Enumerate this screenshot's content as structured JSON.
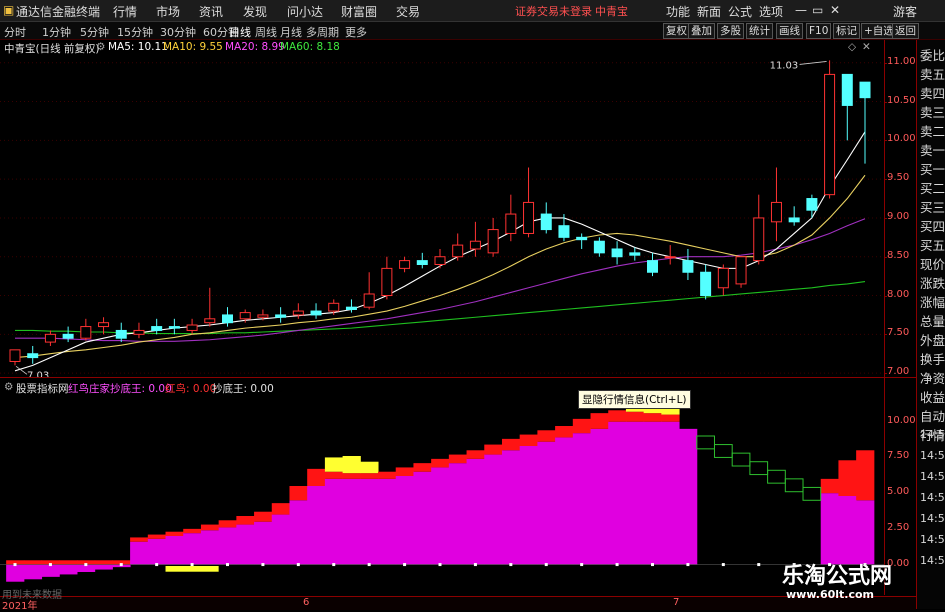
{
  "menubar": {
    "app_title": "通达信金融终端",
    "items": [
      "行情",
      "市场",
      "资讯",
      "发现",
      "问小达",
      "财富圈",
      "交易"
    ],
    "login_notice": "证券交易未登录",
    "stock_name": "中青宝",
    "right_items": [
      "功能",
      "新面",
      "公式",
      "选项"
    ],
    "guest_label": "游客"
  },
  "periodbar": {
    "periods": [
      "分时",
      "1分钟",
      "5分钟",
      "15分钟",
      "30分钟",
      "60分钟",
      "日线",
      "周线",
      "月线",
      "多周期",
      "更多"
    ],
    "active_period": "日线",
    "right_buttons": [
      "复权",
      "叠加",
      "多股",
      "统计",
      "画线",
      "F10",
      "标记",
      "+自选",
      "返回"
    ]
  },
  "main_chart": {
    "title": "中青宝(日线 前复权)",
    "ma5": "MA5: 10.11",
    "ma10": "MA10: 9.55",
    "ma20": "MA20: 8.99",
    "ma60": "MA60: 8.18",
    "high_label": "11.03",
    "low_label": "7.03",
    "y_ticks": [
      "11.00",
      "10.50",
      "10.00",
      "9.50",
      "9.00",
      "8.50",
      "8.00",
      "7.50",
      "7.00"
    ]
  },
  "sub_chart": {
    "name": "股票指标网",
    "line1": "红鸟庄家抄底王: 0.00",
    "line2": "红鸟: 0.00",
    "line3": "抄底王: 0.00",
    "y_ticks": [
      "10.00",
      "7.50",
      "5.00",
      "2.50",
      "0.00"
    ],
    "right_overflow": [
      "14:50",
      "14:50",
      "14:50",
      "14:50",
      "14:50",
      "14:50",
      "14:50"
    ]
  },
  "tooltip": "显隐行情信息(Ctrl+L)",
  "x_axis": {
    "year": "2021年",
    "months": [
      "6",
      "7"
    ]
  },
  "footnote": "用到未来数据",
  "sidebar_items": [
    "委比",
    "卖五",
    "卖四",
    "卖三",
    "卖二",
    "卖一",
    "买一",
    "买二",
    "买三",
    "买四",
    "买五",
    "现价",
    "涨跌",
    "涨幅",
    "总量",
    "外盘",
    "换手",
    "净资",
    "收益",
    "自动",
    "行情"
  ],
  "watermark": {
    "title": "乐淘公式网",
    "url": "www.60lt.com"
  },
  "chart_data": {
    "type": "candlestick",
    "x": [
      1,
      2,
      3,
      4,
      5,
      6,
      7,
      8,
      9,
      10,
      11,
      12,
      13,
      14,
      15,
      16,
      17,
      18,
      19,
      20,
      21,
      22,
      23,
      24,
      25,
      26,
      27,
      28,
      29,
      30,
      31,
      32,
      33,
      34,
      35,
      36,
      37,
      38,
      39,
      40,
      41,
      42,
      43,
      44,
      45,
      46,
      47,
      48,
      49
    ],
    "open": [
      7.15,
      7.25,
      7.4,
      7.5,
      7.45,
      7.6,
      7.55,
      7.5,
      7.6,
      7.6,
      7.55,
      7.65,
      7.75,
      7.7,
      7.72,
      7.75,
      7.75,
      7.8,
      7.8,
      7.85,
      7.85,
      8.0,
      8.35,
      8.45,
      8.4,
      8.5,
      8.6,
      8.55,
      8.8,
      8.8,
      9.05,
      8.9,
      8.75,
      8.7,
      8.6,
      8.55,
      8.45,
      8.5,
      8.45,
      8.3,
      8.1,
      8.15,
      8.45,
      8.95,
      9.0,
      9.25,
      9.3,
      10.85,
      10.75
    ],
    "close": [
      7.3,
      7.2,
      7.5,
      7.45,
      7.6,
      7.65,
      7.45,
      7.55,
      7.55,
      7.58,
      7.62,
      7.7,
      7.65,
      7.78,
      7.75,
      7.72,
      7.8,
      7.75,
      7.9,
      7.82,
      8.02,
      8.35,
      8.45,
      8.4,
      8.5,
      8.65,
      8.7,
      8.85,
      9.05,
      9.2,
      8.85,
      8.75,
      8.72,
      8.55,
      8.5,
      8.52,
      8.3,
      8.5,
      8.3,
      8.0,
      8.35,
      8.5,
      9.0,
      9.2,
      8.95,
      9.1,
      10.85,
      10.45,
      10.55
    ],
    "high": [
      7.3,
      7.35,
      7.55,
      7.6,
      7.7,
      7.72,
      7.65,
      7.65,
      7.7,
      7.7,
      7.7,
      8.1,
      7.85,
      7.82,
      7.82,
      7.85,
      7.9,
      7.9,
      7.95,
      7.95,
      8.3,
      8.5,
      8.5,
      8.55,
      8.6,
      8.8,
      8.95,
      9.0,
      9.3,
      9.65,
      9.2,
      9.05,
      8.8,
      8.75,
      8.7,
      8.62,
      8.55,
      8.65,
      8.6,
      8.4,
      8.4,
      8.5,
      9.3,
      9.65,
      9.15,
      9.3,
      11.03,
      10.6,
      10.6
    ],
    "low": [
      7.1,
      7.12,
      7.35,
      7.4,
      7.42,
      7.5,
      7.4,
      7.45,
      7.5,
      7.5,
      7.5,
      7.6,
      7.6,
      7.65,
      7.68,
      7.65,
      7.7,
      7.7,
      7.75,
      7.78,
      7.82,
      7.95,
      8.3,
      8.35,
      8.35,
      8.45,
      8.5,
      8.5,
      8.7,
      8.75,
      8.8,
      8.7,
      8.6,
      8.5,
      8.4,
      8.45,
      8.25,
      8.4,
      8.2,
      7.95,
      8.0,
      8.1,
      8.4,
      8.7,
      8.9,
      9.0,
      9.25,
      10.0,
      9.7
    ],
    "ma5": [
      7.03,
      7.1,
      7.2,
      7.3,
      7.4,
      7.45,
      7.5,
      7.52,
      7.55,
      7.58,
      7.6,
      7.62,
      7.65,
      7.68,
      7.7,
      7.72,
      7.74,
      7.76,
      7.78,
      7.82,
      7.9,
      8.0,
      8.12,
      8.25,
      8.38,
      8.5,
      8.6,
      8.7,
      8.82,
      8.95,
      9.0,
      9.0,
      8.92,
      8.82,
      8.72,
      8.62,
      8.55,
      8.5,
      8.45,
      8.4,
      8.35,
      8.35,
      8.45,
      8.6,
      8.8,
      9.0,
      9.4,
      9.75,
      10.11
    ],
    "ma10": [
      7.2,
      7.22,
      7.25,
      7.28,
      7.3,
      7.33,
      7.36,
      7.4,
      7.43,
      7.46,
      7.5,
      7.52,
      7.55,
      7.58,
      7.6,
      7.62,
      7.65,
      7.67,
      7.7,
      7.72,
      7.76,
      7.8,
      7.86,
      7.93,
      8.0,
      8.08,
      8.17,
      8.27,
      8.38,
      8.5,
      8.6,
      8.68,
      8.74,
      8.78,
      8.8,
      8.78,
      8.74,
      8.7,
      8.65,
      8.6,
      8.55,
      8.5,
      8.5,
      8.55,
      8.65,
      8.78,
      9.0,
      9.25,
      9.55
    ],
    "ma20": [
      7.45,
      7.45,
      7.45,
      7.44,
      7.43,
      7.42,
      7.42,
      7.41,
      7.41,
      7.41,
      7.42,
      7.43,
      7.45,
      7.47,
      7.49,
      7.52,
      7.55,
      7.58,
      7.61,
      7.64,
      7.67,
      7.7,
      7.74,
      7.78,
      7.82,
      7.87,
      7.92,
      7.98,
      8.04,
      8.1,
      8.16,
      8.22,
      8.28,
      8.33,
      8.38,
      8.42,
      8.45,
      8.48,
      8.5,
      8.5,
      8.5,
      8.52,
      8.55,
      8.6,
      8.65,
      8.72,
      8.8,
      8.9,
      8.99
    ],
    "ma60": [
      7.55,
      7.55,
      7.54,
      7.54,
      7.53,
      7.53,
      7.52,
      7.52,
      7.51,
      7.51,
      7.51,
      7.51,
      7.52,
      7.52,
      7.53,
      7.54,
      7.55,
      7.56,
      7.57,
      7.58,
      7.6,
      7.62,
      7.64,
      7.66,
      7.68,
      7.7,
      7.72,
      7.74,
      7.76,
      7.78,
      7.8,
      7.82,
      7.84,
      7.86,
      7.88,
      7.9,
      7.92,
      7.94,
      7.96,
      7.98,
      8.0,
      8.02,
      8.04,
      8.06,
      8.08,
      8.1,
      8.13,
      8.15,
      8.18
    ],
    "ylim": [
      6.95,
      11.1
    ],
    "indicator": {
      "steps": [
        0.2,
        0.4,
        0.6,
        0.8,
        1.0,
        1.2,
        1.4,
        1.6,
        1.8,
        2.0,
        2.2,
        2.4,
        2.6,
        2.8,
        3.0,
        3.5,
        4.5,
        5.5,
        6.0,
        6.0,
        6.0,
        6.0,
        6.2,
        6.5,
        6.8,
        7.1,
        7.4,
        7.7,
        8.0,
        8.3,
        8.6,
        8.9,
        9.2,
        9.5,
        10.0,
        10.0,
        10.0,
        10.0,
        9.5,
        9.0,
        8.4,
        7.8,
        7.2,
        6.6,
        6.0,
        5.4,
        5.0,
        4.8,
        4.5
      ],
      "red_extra": [
        0.3,
        0.3,
        0.3,
        0.3,
        0.3,
        0.3,
        0.3,
        0.3,
        0.3,
        0.3,
        0.3,
        0.4,
        0.5,
        0.6,
        0.7,
        0.8,
        1.0,
        1.2,
        0.5,
        0.4,
        0.4,
        0.5,
        0.6,
        0.6,
        0.6,
        0.6,
        0.6,
        0.7,
        0.8,
        0.8,
        0.8,
        0.8,
        1.0,
        1.1,
        0.8,
        0.7,
        0.6,
        0.5,
        0,
        0,
        0,
        0,
        0,
        0,
        0,
        0,
        1.0,
        2.5,
        3.5
      ],
      "yellow_extra": [
        0,
        0,
        0,
        0,
        0,
        0,
        0,
        0,
        0,
        0,
        0,
        0,
        0,
        0,
        0,
        0,
        0,
        0,
        1.0,
        1.2,
        0.8,
        0,
        0,
        0,
        0,
        0,
        0,
        0,
        0,
        0,
        0,
        0,
        0,
        0,
        0,
        1.2,
        1.0,
        0.4,
        0,
        0,
        0,
        0,
        0,
        0,
        0,
        0,
        0,
        0,
        0
      ],
      "ylim": [
        -1.5,
        11.8
      ]
    }
  }
}
